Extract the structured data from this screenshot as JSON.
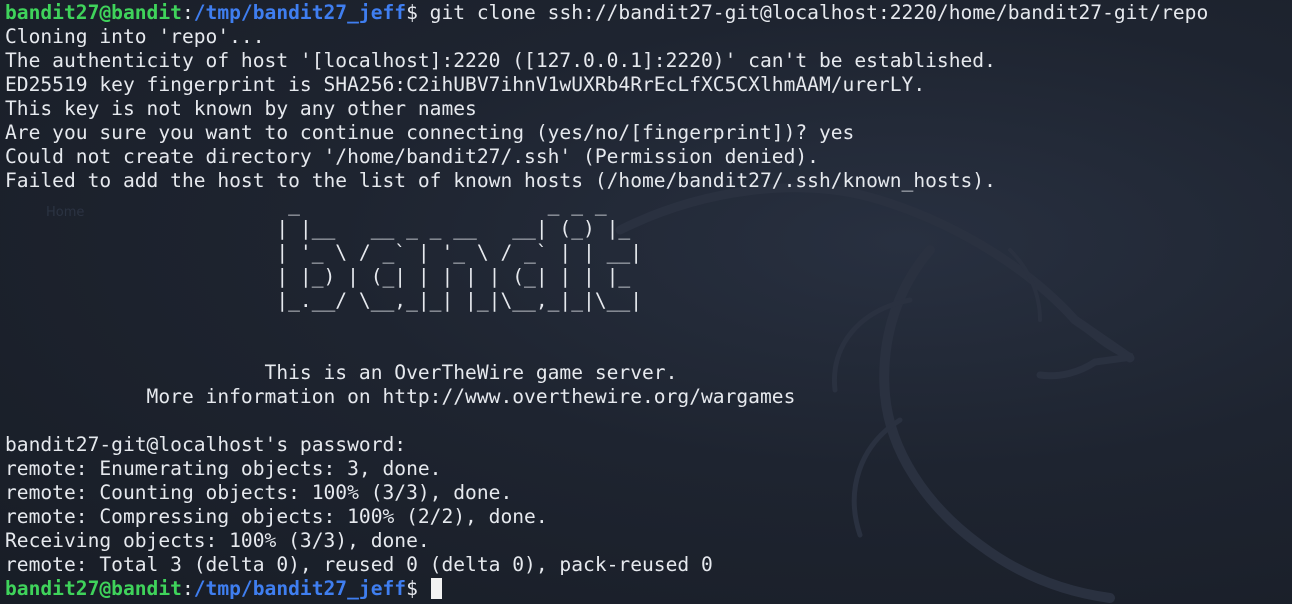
{
  "prompt": {
    "user": "bandit27@bandit",
    "sep": ":",
    "path": "/tmp/bandit27_jeff",
    "symbol": "$"
  },
  "command": " git clone ssh://bandit27-git@localhost:2220/home/bandit27-git/repo",
  "output": {
    "cloning": "Cloning into 'repo'...",
    "authenticity": "The authenticity of host '[localhost]:2220 ([127.0.0.1]:2220)' can't be established.",
    "fingerprint": "ED25519 key fingerprint is SHA256:C2ihUBV7ihnV1wUXRb4RrEcLfXC5CXlhmAAM/urerLY.",
    "not_known": "This key is not known by any other names",
    "continue_question": "Are you sure you want to continue connecting (yes/no/[fingerprint])? yes",
    "could_not_create": "Could not create directory '/home/bandit27/.ssh' (Permission denied).",
    "failed_add": "Failed to add the host to the list of known hosts (/home/bandit27/.ssh/known_hosts).",
    "banner": [
      "                        _                     _ _ _   ",
      "                       | |__   __ _ _ __   __| (_) |_ ",
      "                       | '_ \\ / _` | '_ \\ / _` | | __|",
      "                       | |_) | (_| | | | | (_| | | |_ ",
      "                       |_.__/ \\__,_|_| |_|\\__,_|_|\\__|",
      "",
      "",
      "                      This is an OverTheWire game server.",
      "            More information on http://www.overthewire.org/wargames",
      ""
    ],
    "password_prompt": "bandit27-git@localhost's password: ",
    "remote_enumerating": "remote: Enumerating objects: 3, done.",
    "remote_counting": "remote: Counting objects: 100% (3/3), done.",
    "remote_compressing": "remote: Compressing objects: 100% (2/2), done.",
    "receiving": "Receiving objects: 100% (3/3), done.",
    "remote_total": "remote: Total 3 (delta 0), reused 0 (delta 0), pack-reused 0"
  },
  "background_label": "Home",
  "colors": {
    "background": "#1c222c",
    "text": "#e6e9ee",
    "prompt_user": "#3fd35b",
    "prompt_path": "#3f7ef0"
  },
  "icons": {
    "watermark": "kali-dragon-icon"
  }
}
